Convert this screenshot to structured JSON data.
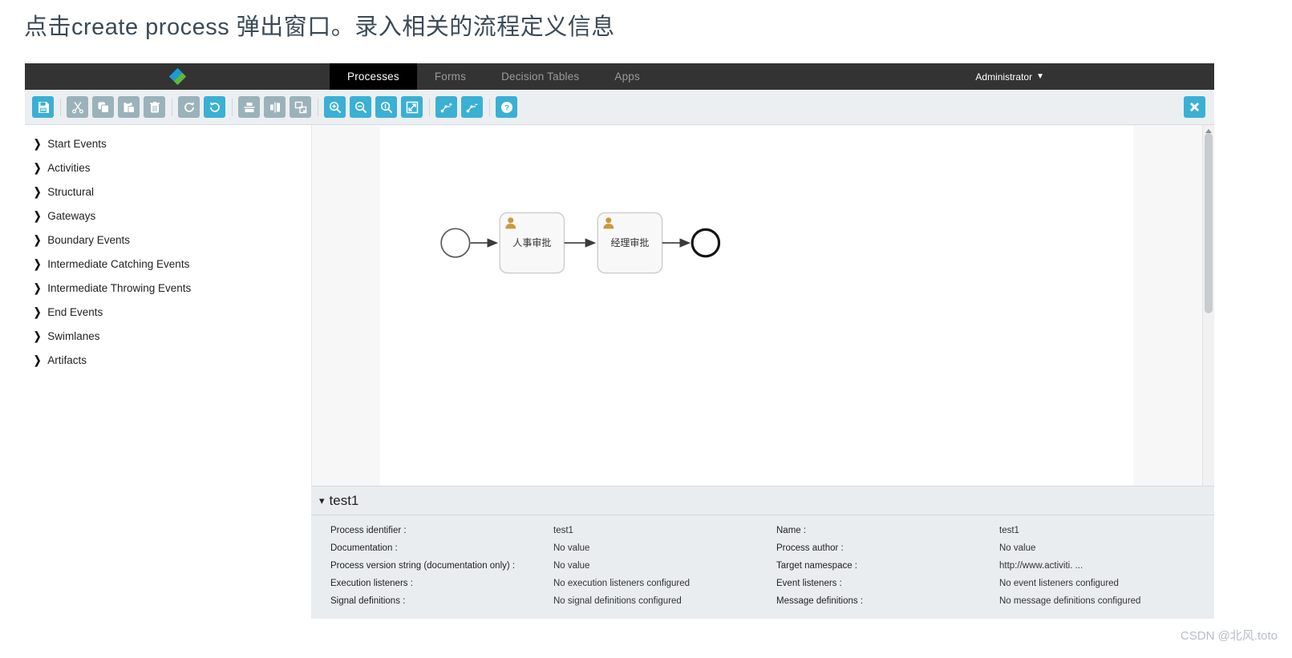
{
  "caption": "点击create process 弹出窗口。录入相关的流程定义信息",
  "navbar": {
    "logo_icon": "diamond-logo-icon",
    "tabs": [
      {
        "label": "Processes",
        "active": true
      },
      {
        "label": "Forms",
        "active": false
      },
      {
        "label": "Decision Tables",
        "active": false
      },
      {
        "label": "Apps",
        "active": false
      }
    ],
    "user": "Administrator",
    "user_caret": "❤"
  },
  "toolbar": {
    "buttons": [
      {
        "name": "save-icon",
        "title": "Save",
        "state": "active"
      },
      {
        "name": "cut-icon",
        "title": "Cut",
        "state": "disabled"
      },
      {
        "name": "copy-icon",
        "title": "Copy",
        "state": "disabled"
      },
      {
        "name": "paste-icon",
        "title": "Paste",
        "state": "disabled"
      },
      {
        "name": "delete-icon",
        "title": "Delete",
        "state": "disabled"
      },
      {
        "name": "redo-icon",
        "title": "Redo",
        "state": "disabled"
      },
      {
        "name": "undo-icon",
        "title": "Undo",
        "state": "active"
      },
      {
        "name": "align-vertical-icon",
        "title": "Align vertical",
        "state": "disabled"
      },
      {
        "name": "align-horizontal-icon",
        "title": "Align horizontal",
        "state": "disabled"
      },
      {
        "name": "same-size-icon",
        "title": "Same size",
        "state": "disabled"
      },
      {
        "name": "zoom-in-icon",
        "title": "Zoom in",
        "state": "active"
      },
      {
        "name": "zoom-out-icon",
        "title": "Zoom out",
        "state": "active"
      },
      {
        "name": "zoom-actual-icon",
        "title": "Zoom actual size",
        "state": "active"
      },
      {
        "name": "zoom-fit-icon",
        "title": "Zoom to fit",
        "state": "active"
      },
      {
        "name": "add-bendpoint-icon",
        "title": "Add bendpoint",
        "state": "active"
      },
      {
        "name": "remove-bendpoint-icon",
        "title": "Remove bendpoint",
        "state": "active"
      },
      {
        "name": "help-icon",
        "title": "Help",
        "state": "active"
      }
    ],
    "close_label": "✖",
    "accent_active": "#3ab0d4",
    "accent_disabled": "#9bb2ba"
  },
  "palette": {
    "items": [
      {
        "label": "Start Events"
      },
      {
        "label": "Activities"
      },
      {
        "label": "Structural"
      },
      {
        "label": "Gateways"
      },
      {
        "label": "Boundary Events"
      },
      {
        "label": "Intermediate Catching Events"
      },
      {
        "label": "Intermediate Throwing Events"
      },
      {
        "label": "End Events"
      },
      {
        "label": "Swimlanes"
      },
      {
        "label": "Artifacts"
      }
    ]
  },
  "diagram": {
    "start_event": {
      "type": "start-event",
      "label": ""
    },
    "tasks": [
      {
        "label": "人事审批",
        "type": "user-task"
      },
      {
        "label": "经理审批",
        "type": "user-task"
      }
    ],
    "end_event": {
      "type": "end-event",
      "label": ""
    }
  },
  "properties": {
    "title": "test1",
    "caret": "⌄",
    "rows": [
      {
        "label": "Process identifier :",
        "value": "test1",
        "label2": "Name :",
        "value2": "test1"
      },
      {
        "label": "Documentation :",
        "value": "No value",
        "label2": "Process author :",
        "value2": "No value"
      },
      {
        "label": "Process version string (documentation only) :",
        "value": "No value",
        "label2": "Target namespace :",
        "value2": "http://www.activiti. ..."
      },
      {
        "label": "Execution listeners :",
        "value": "No execution listeners configured",
        "label2": "Event listeners :",
        "value2": "No event listeners configured"
      },
      {
        "label": "Signal definitions :",
        "value": "No signal definitions configured",
        "label2": "Message definitions :",
        "value2": "No message definitions configured"
      }
    ]
  },
  "watermark": "CSDN @北风.toto"
}
